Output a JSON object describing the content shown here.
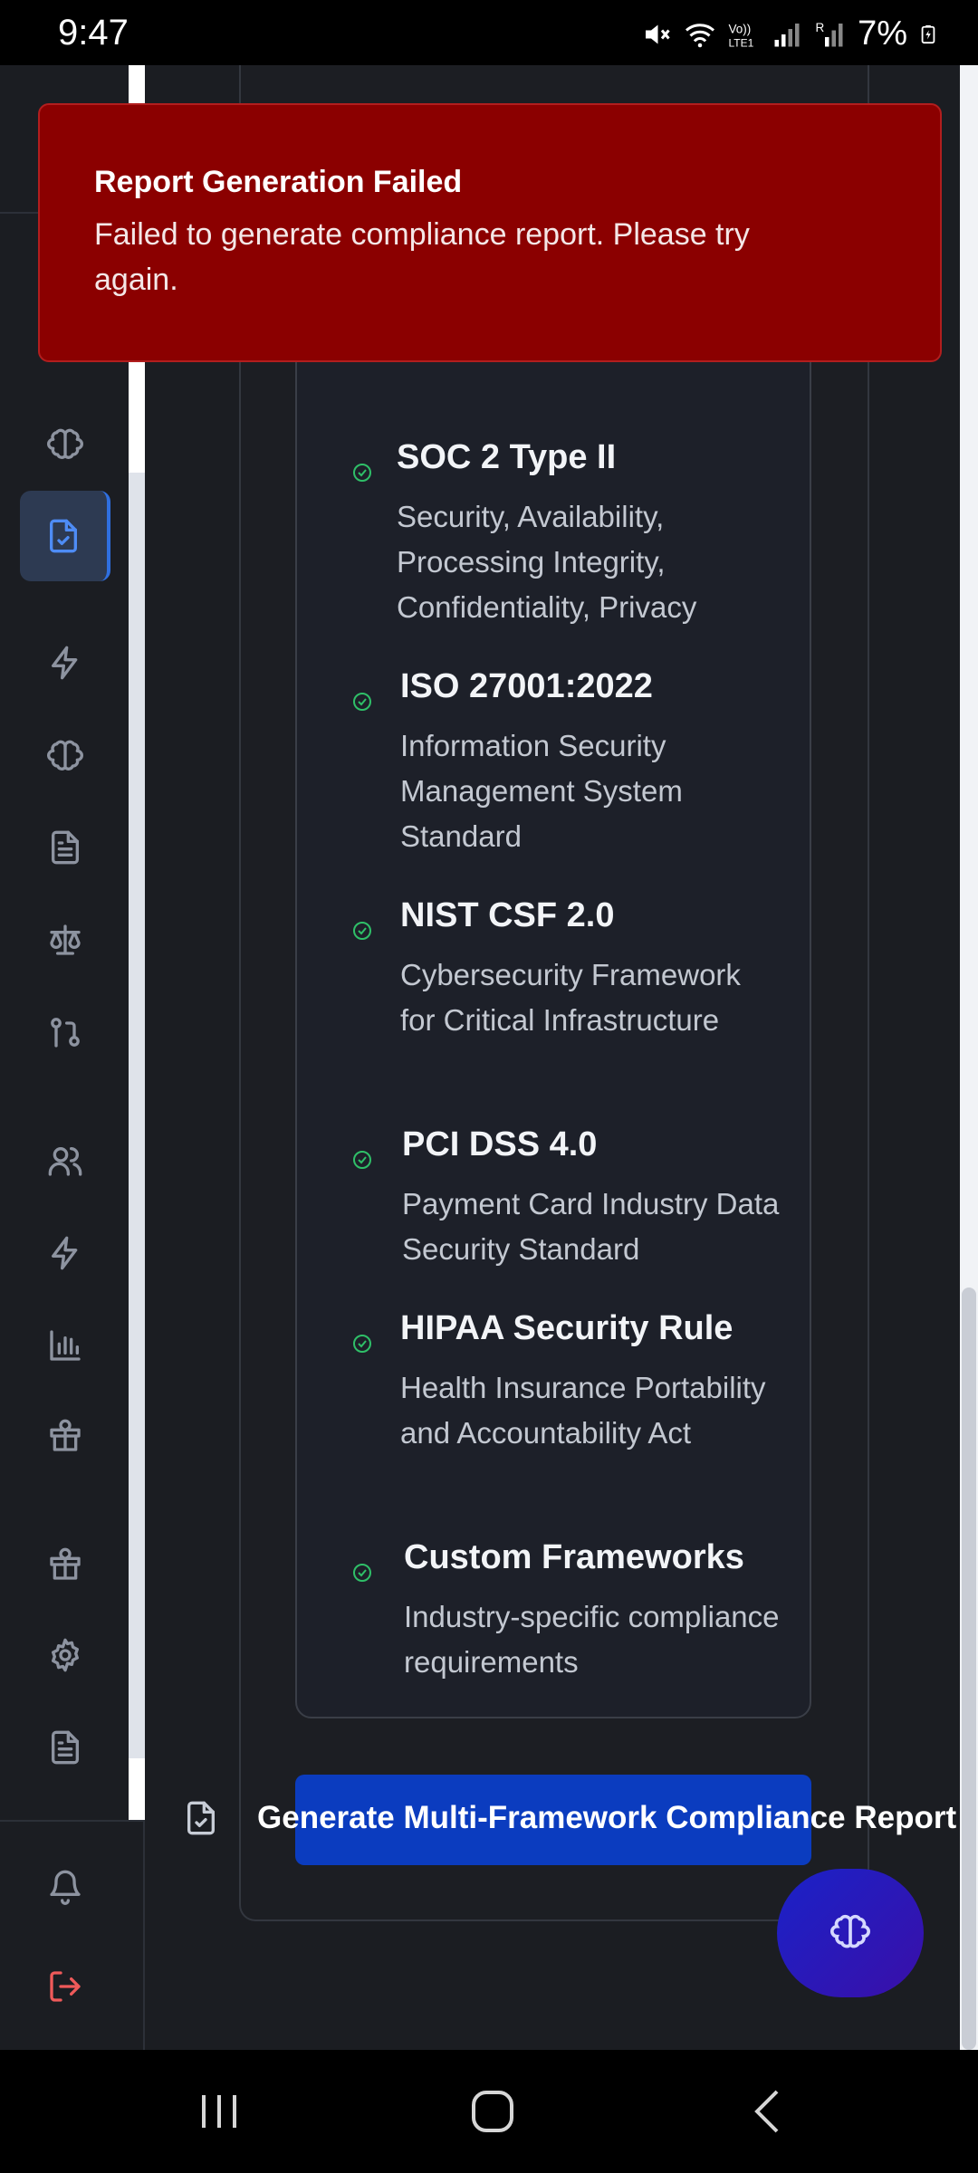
{
  "status_bar": {
    "time": "9:47",
    "battery": "7%",
    "icons": [
      "mute-icon",
      "wifi-icon",
      "volte-icon",
      "signal-icon",
      "signal-roaming-icon",
      "battery-charging-icon"
    ]
  },
  "sidebar": {
    "items": [
      {
        "name": "brain-icon",
        "active": false
      },
      {
        "name": "file-check-icon",
        "active": true
      },
      {
        "name": "lightning-icon",
        "active": false
      },
      {
        "name": "brain-icon",
        "active": false
      },
      {
        "name": "document-icon",
        "active": false
      },
      {
        "name": "scale-icon",
        "active": false
      },
      {
        "name": "git-pull-request-icon",
        "active": false
      },
      {
        "name": "users-icon",
        "active": false
      },
      {
        "name": "lightning-icon",
        "active": false
      },
      {
        "name": "bar-chart-icon",
        "active": false
      },
      {
        "name": "gift-icon",
        "active": false
      },
      {
        "name": "gift-icon",
        "active": false
      },
      {
        "name": "gear-icon",
        "active": false
      },
      {
        "name": "document-icon",
        "active": false
      },
      {
        "name": "bell-icon",
        "active": false
      },
      {
        "name": "logout-icon",
        "active": false
      }
    ],
    "active_color": "#4e8cf5",
    "logout_color": "#ef5a5a"
  },
  "toast": {
    "title": "Report Generation Failed",
    "message": "Failed to generate compliance report. Please try again.",
    "background": "#8b0000"
  },
  "frameworks": [
    {
      "title": "SOC 2 Type II",
      "description": "Security, Availability, Processing Integrity, Confidentiality, Privacy"
    },
    {
      "title": "ISO 27001:2022",
      "description": "Information Security Management System Standard"
    },
    {
      "title": "NIST CSF 2.0",
      "description": "Cybersecurity Framework for Critical Infrastructure"
    },
    {
      "title": "PCI DSS 4.0",
      "description": "Payment Card Industry Data Security Standard"
    },
    {
      "title": "HIPAA Security Rule",
      "description": "Health Insurance Portability and Accountability Act"
    },
    {
      "title": "Custom Frameworks",
      "description": "Industry-specific compliance requirements"
    }
  ],
  "generate": {
    "label": "Generate Multi-Framework Compliance Report",
    "button_color": "#0b3cbf"
  },
  "fab": {
    "icon": "brain-icon"
  },
  "nav_bar": {
    "buttons": [
      "recent-apps-icon",
      "home-icon",
      "back-icon"
    ]
  }
}
